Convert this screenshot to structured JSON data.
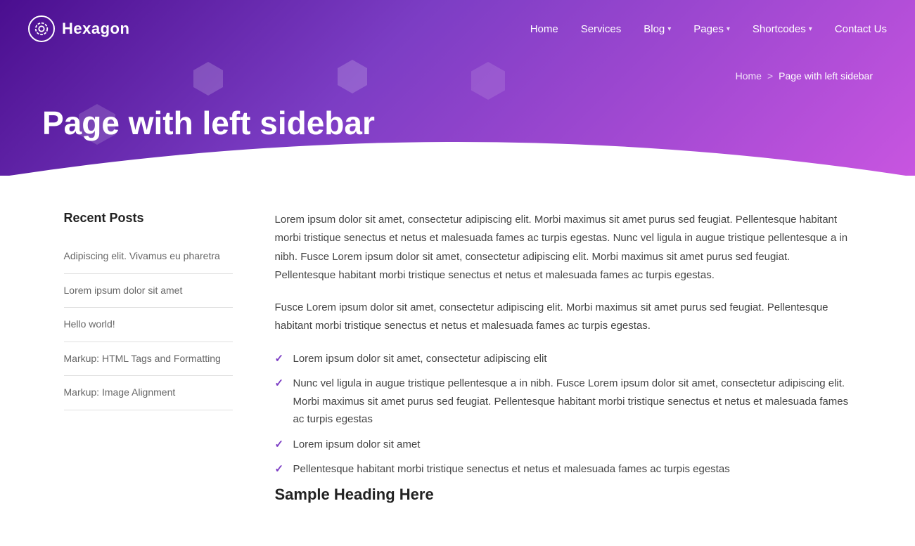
{
  "site": {
    "name": "Hexagon"
  },
  "nav": {
    "items": [
      {
        "label": "Home",
        "has_dropdown": false
      },
      {
        "label": "Services",
        "has_dropdown": false
      },
      {
        "label": "Blog",
        "has_dropdown": true
      },
      {
        "label": "Pages",
        "has_dropdown": true
      },
      {
        "label": "Shortcodes",
        "has_dropdown": true
      },
      {
        "label": "Contact Us",
        "has_dropdown": false
      }
    ]
  },
  "hero": {
    "title": "Page with left sidebar",
    "breadcrumb_home": "Home",
    "breadcrumb_separator": ">",
    "breadcrumb_current": "Page with left sidebar"
  },
  "sidebar": {
    "title": "Recent Posts",
    "posts": [
      {
        "label": "Adipiscing elit. Vivamus eu pharetra"
      },
      {
        "label": "Lorem ipsum dolor sit amet"
      },
      {
        "label": "Hello world!"
      },
      {
        "label": "Markup: HTML Tags and Formatting"
      },
      {
        "label": "Markup: Image Alignment"
      }
    ]
  },
  "content": {
    "paragraph1": "Lorem ipsum dolor sit amet, consectetur adipiscing elit. Morbi maximus sit amet purus sed feugiat. Pellentesque habitant morbi tristique senectus et netus et malesuada fames ac turpis egestas. Nunc vel ligula in augue tristique pellentesque a in nibh. Fusce Lorem ipsum dolor sit amet, consectetur adipiscing elit. Morbi maximus sit amet purus sed feugiat. Pellentesque habitant morbi tristique senectus et netus et malesuada fames ac turpis egestas.",
    "paragraph2": "Fusce Lorem ipsum dolor sit amet, consectetur adipiscing elit. Morbi maximus sit amet purus sed feugiat. Pellentesque habitant morbi tristique senectus et netus et malesuada fames ac turpis egestas.",
    "check_items": [
      "Lorem ipsum dolor sit amet, consectetur adipiscing elit",
      "Nunc vel ligula in augue tristique pellentesque a in nibh. Fusce Lorem ipsum dolor sit amet, consectetur adipiscing elit. Morbi maximus sit amet purus sed feugiat. Pellentesque habitant morbi tristique senectus et netus et malesuada fames ac turpis egestas",
      "Lorem ipsum dolor sit amet",
      "Pellentesque habitant morbi tristique senectus et netus et malesuada fames ac turpis egestas"
    ],
    "sample_heading": "Sample Heading Here"
  },
  "colors": {
    "accent": "#7c3dc4",
    "hero_gradient_start": "#4a0e8f",
    "hero_gradient_end": "#c855e0"
  }
}
